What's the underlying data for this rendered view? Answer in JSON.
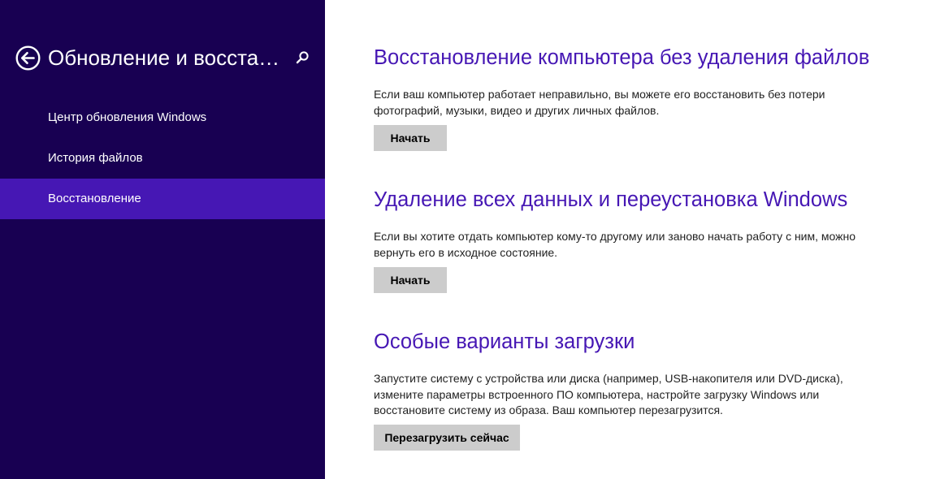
{
  "colors": {
    "sidebar_bg": "#180052",
    "selected_bg": "#4617b4",
    "heading_color": "#4617b4",
    "button_bg": "#cccccc"
  },
  "header": {
    "title": "Обновление и восстан...",
    "back_icon": "back-arrow-circle-icon",
    "search_icon": "search-icon"
  },
  "nav": {
    "items": [
      {
        "label": "Центр обновления Windows"
      },
      {
        "label": "История файлов"
      },
      {
        "label": "Восстановление",
        "selected": true
      }
    ]
  },
  "sections": [
    {
      "title": "Восстановление компьютера без удаления файлов",
      "description": "Если ваш компьютер работает неправильно, вы можете его восстановить без потери фотографий, музыки, видео и других личных файлов.",
      "button": "Начать"
    },
    {
      "title": "Удаление всех данных и переустановка Windows",
      "description": "Если вы хотите отдать компьютер кому-то другому или заново начать работу с ним, можно вернуть его в исходное состояние.",
      "button": "Начать"
    },
    {
      "title": "Особые варианты загрузки",
      "description": "Запустите систему с устройства или диска (например, USB-накопителя или DVD-диска), измените параметры встроенного ПО компьютера, настройте загрузку Windows или восстановите систему из образа. Ваш компьютер перезагрузится.",
      "button": "Перезагрузить сейчас"
    }
  ]
}
